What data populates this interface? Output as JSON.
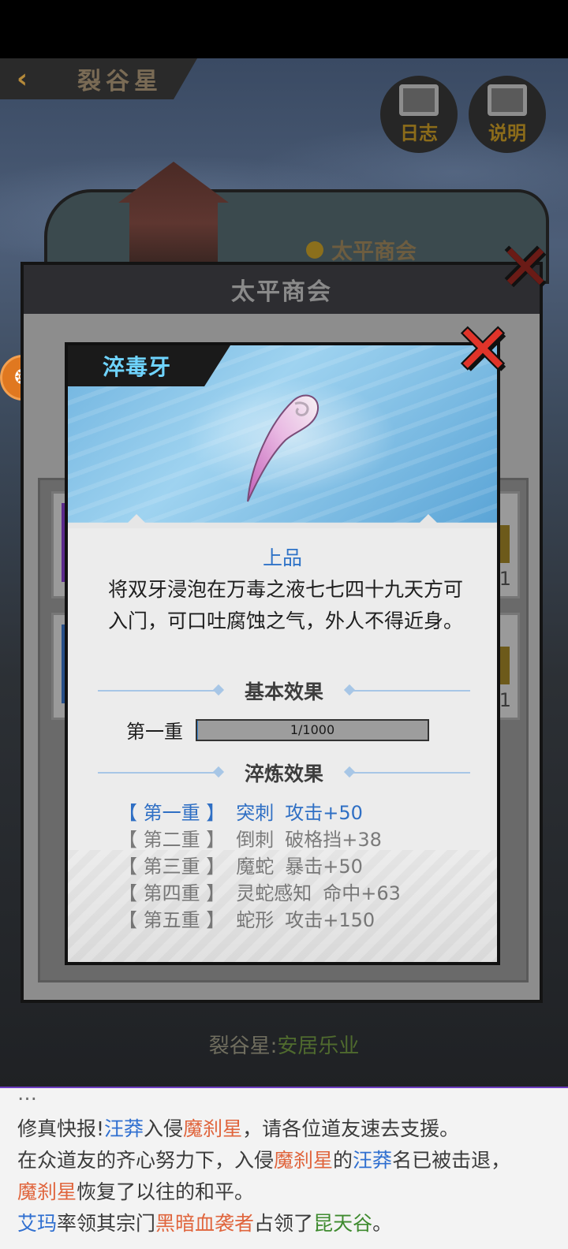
{
  "header": {
    "back_label": "‹",
    "planet_name": "裂谷星",
    "log_label": "日志",
    "help_label": "说明"
  },
  "town": {
    "merchant_label": "太平商会"
  },
  "side_badge": {
    "glyph": "❂"
  },
  "shop": {
    "title": "太平商会",
    "items": [
      {
        "qty": "1",
        "color": "#5b2a8c"
      },
      {
        "qty": "1",
        "color": "#274f88"
      }
    ]
  },
  "popup": {
    "item_name": "淬毒牙",
    "rarity": "上品",
    "description": "将双牙浸泡在万毒之液七七四十九天方可入门，可口吐腐蚀之气，外人不得近身。",
    "basic_section_title": "基本效果",
    "tier_label": "第一重",
    "progress_text": "1/1000",
    "progress_fraction": 0.001,
    "refine_section_title": "淬炼效果",
    "effects": [
      {
        "tier": "【 第一重 】",
        "name": "突刺",
        "bonus": "攻击+50",
        "active": true
      },
      {
        "tier": "【 第二重 】",
        "name": "倒刺",
        "bonus": "破格挡+38",
        "active": false
      },
      {
        "tier": "【 第三重 】",
        "name": "魔蛇",
        "bonus": "暴击+50",
        "active": false
      },
      {
        "tier": "【 第四重 】",
        "name": "灵蛇感知",
        "bonus": "命中+63",
        "active": false
      },
      {
        "tier": "【 第五重 】",
        "name": "蛇形",
        "bonus": "攻击+150",
        "active": false
      }
    ],
    "close_glyph": "✕"
  },
  "planet_status": {
    "prefix": "裂谷星:",
    "state": "安居乐业"
  },
  "news": {
    "line1": {
      "a": "修真快报!",
      "b": "汪莽",
      "c": "入侵",
      "d": "魔刹星",
      "e": "，请各位道友速去支援。"
    },
    "line2": {
      "a": "在众道友的齐心努力下，入侵",
      "b": "魔刹星",
      "c": "的",
      "d": "汪莽",
      "e": "名已被击退，"
    },
    "line3": {
      "a": "魔刹星",
      "b": "恢复了以往的和平。"
    },
    "line4": {
      "a": "艾玛",
      "b": "率领其宗门",
      "c": "黑暗血袭者",
      "d": "占领了",
      "e": "昆天谷",
      "f": "。"
    }
  },
  "colors": {
    "accent_blue": "#2f73c7",
    "close_red": "#e0342a",
    "title_cyan": "#6fd4ff",
    "news_player": "#2f6fd0",
    "news_planet": "#e0653d",
    "news_place": "#3e8a2e"
  }
}
